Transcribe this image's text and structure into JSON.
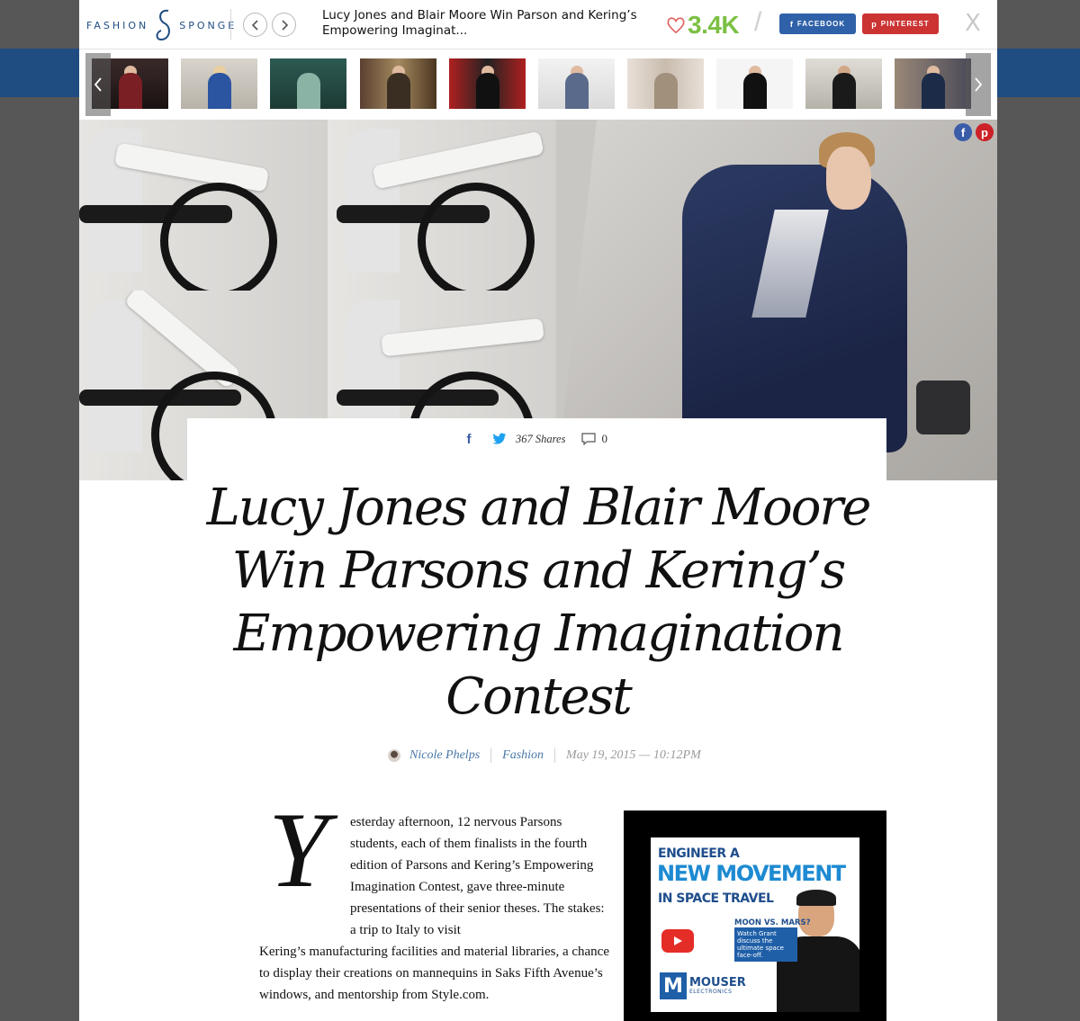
{
  "site": {
    "logo_left": "FASHION",
    "logo_right": "SPONGE"
  },
  "topbar": {
    "title": "Lucy Jones and Blair Moore Win Parson and Kering’s Empowering Imaginat...",
    "like_count": "3.4K",
    "slash": "/",
    "facebook_label": "FACEBOOK",
    "pinterest_label": "PINTEREST",
    "close_label": "X",
    "like_color": "#7bc043",
    "facebook_color": "#2f61a8",
    "pinterest_color": "#cc3333"
  },
  "carousel": {
    "thumbnails_count": 10
  },
  "hero": {
    "facebook_icon": "f",
    "pinterest_icon": "p"
  },
  "article": {
    "facebook_icon": "f",
    "shares": "367 Shares",
    "comments": "0",
    "headline": "Lucy Jones and Blair Moore Win Parsons and Kering’s Empowering Imagination Contest",
    "author": "Nicole Phelps",
    "category": "Fashion",
    "date": "May 19, 2015 — 10:12PM",
    "dropcap": "Y",
    "body_indent": "esterday afternoon, 12 nervous Parsons students, each of them finalists in the fourth edition of Parsons and Kering’s Empowering Imagination Contest, gave three-minute presentations of their senior theses. The stakes: a trip to Italy to visit",
    "body_full": "Kering’s manufacturing facilities and material libraries, a chance to display their creations on mannequins in Saks Fifth Avenue’s windows, and mentorship from Style.com."
  },
  "ad": {
    "line1": "ENGINEER A",
    "line2": "NEW MOVEMENT",
    "line3": "IN SPACE TRAVEL",
    "question": "MOON VS. MARS?",
    "box_text": "Watch Grant discuss the ultimate space face-off.",
    "logo_mark": "M",
    "brand": "MOUSER",
    "brand_sub": "ELECTRONICS"
  }
}
